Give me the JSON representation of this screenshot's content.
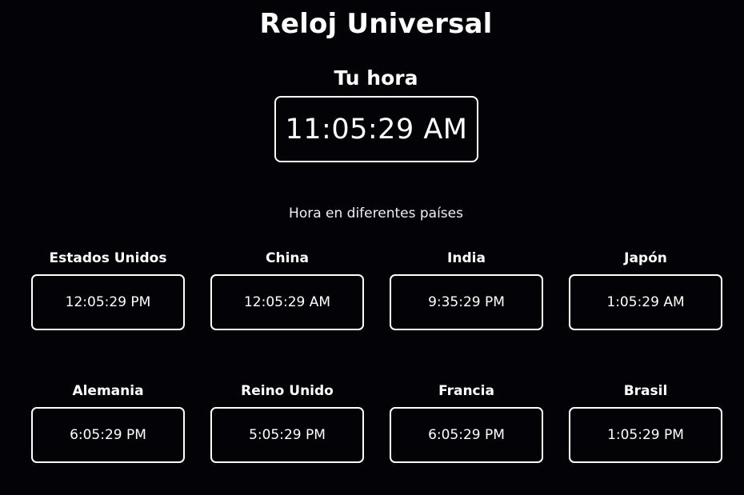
{
  "header": {
    "title": "Reloj Universal"
  },
  "local": {
    "label": "Tu hora",
    "time": "11:05:29 AM"
  },
  "world": {
    "subtitle": "Hora en diferentes países",
    "countries": [
      {
        "name": "Estados Unidos",
        "time": "12:05:29 PM"
      },
      {
        "name": "China",
        "time": "12:05:29 AM"
      },
      {
        "name": "India",
        "time": "9:35:29 PM"
      },
      {
        "name": "Japón",
        "time": "1:05:29 AM"
      },
      {
        "name": "Alemania",
        "time": "6:05:29 PM"
      },
      {
        "name": "Reino Unido",
        "time": "5:05:29 PM"
      },
      {
        "name": "Francia",
        "time": "6:05:29 PM"
      },
      {
        "name": "Brasil",
        "time": "1:05:29 PM"
      }
    ]
  },
  "colors": {
    "background": "#030307",
    "text": "#ffffff",
    "border": "#ffffff"
  }
}
